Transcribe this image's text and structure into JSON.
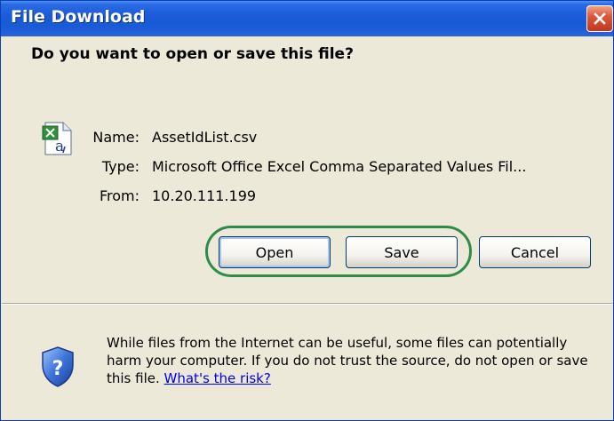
{
  "window": {
    "title": "File Download",
    "close_icon": "close-icon"
  },
  "dialog": {
    "question": "Do you want to open or save this file?",
    "file_icon": "excel-csv-file-icon",
    "name_label": "Name:",
    "name_value": "AssetIdList.csv",
    "type_label": "Type:",
    "type_value": "Microsoft Office Excel Comma Separated Values Fil...",
    "from_label": "From:",
    "from_value": "10.20.111.199"
  },
  "buttons": {
    "open_label": "Open",
    "save_label": "Save",
    "cancel_label": "Cancel"
  },
  "warning": {
    "icon": "security-shield-icon",
    "text": "While files from the Internet can be useful, some files can potentially harm your computer. If you do not trust the source, do not open or save this file. ",
    "link_text": "What's the risk?"
  },
  "colors": {
    "titlebar": "#2a62dc",
    "highlight_ring": "#2f8b4a",
    "dialog_bg": "#ece9d8"
  }
}
